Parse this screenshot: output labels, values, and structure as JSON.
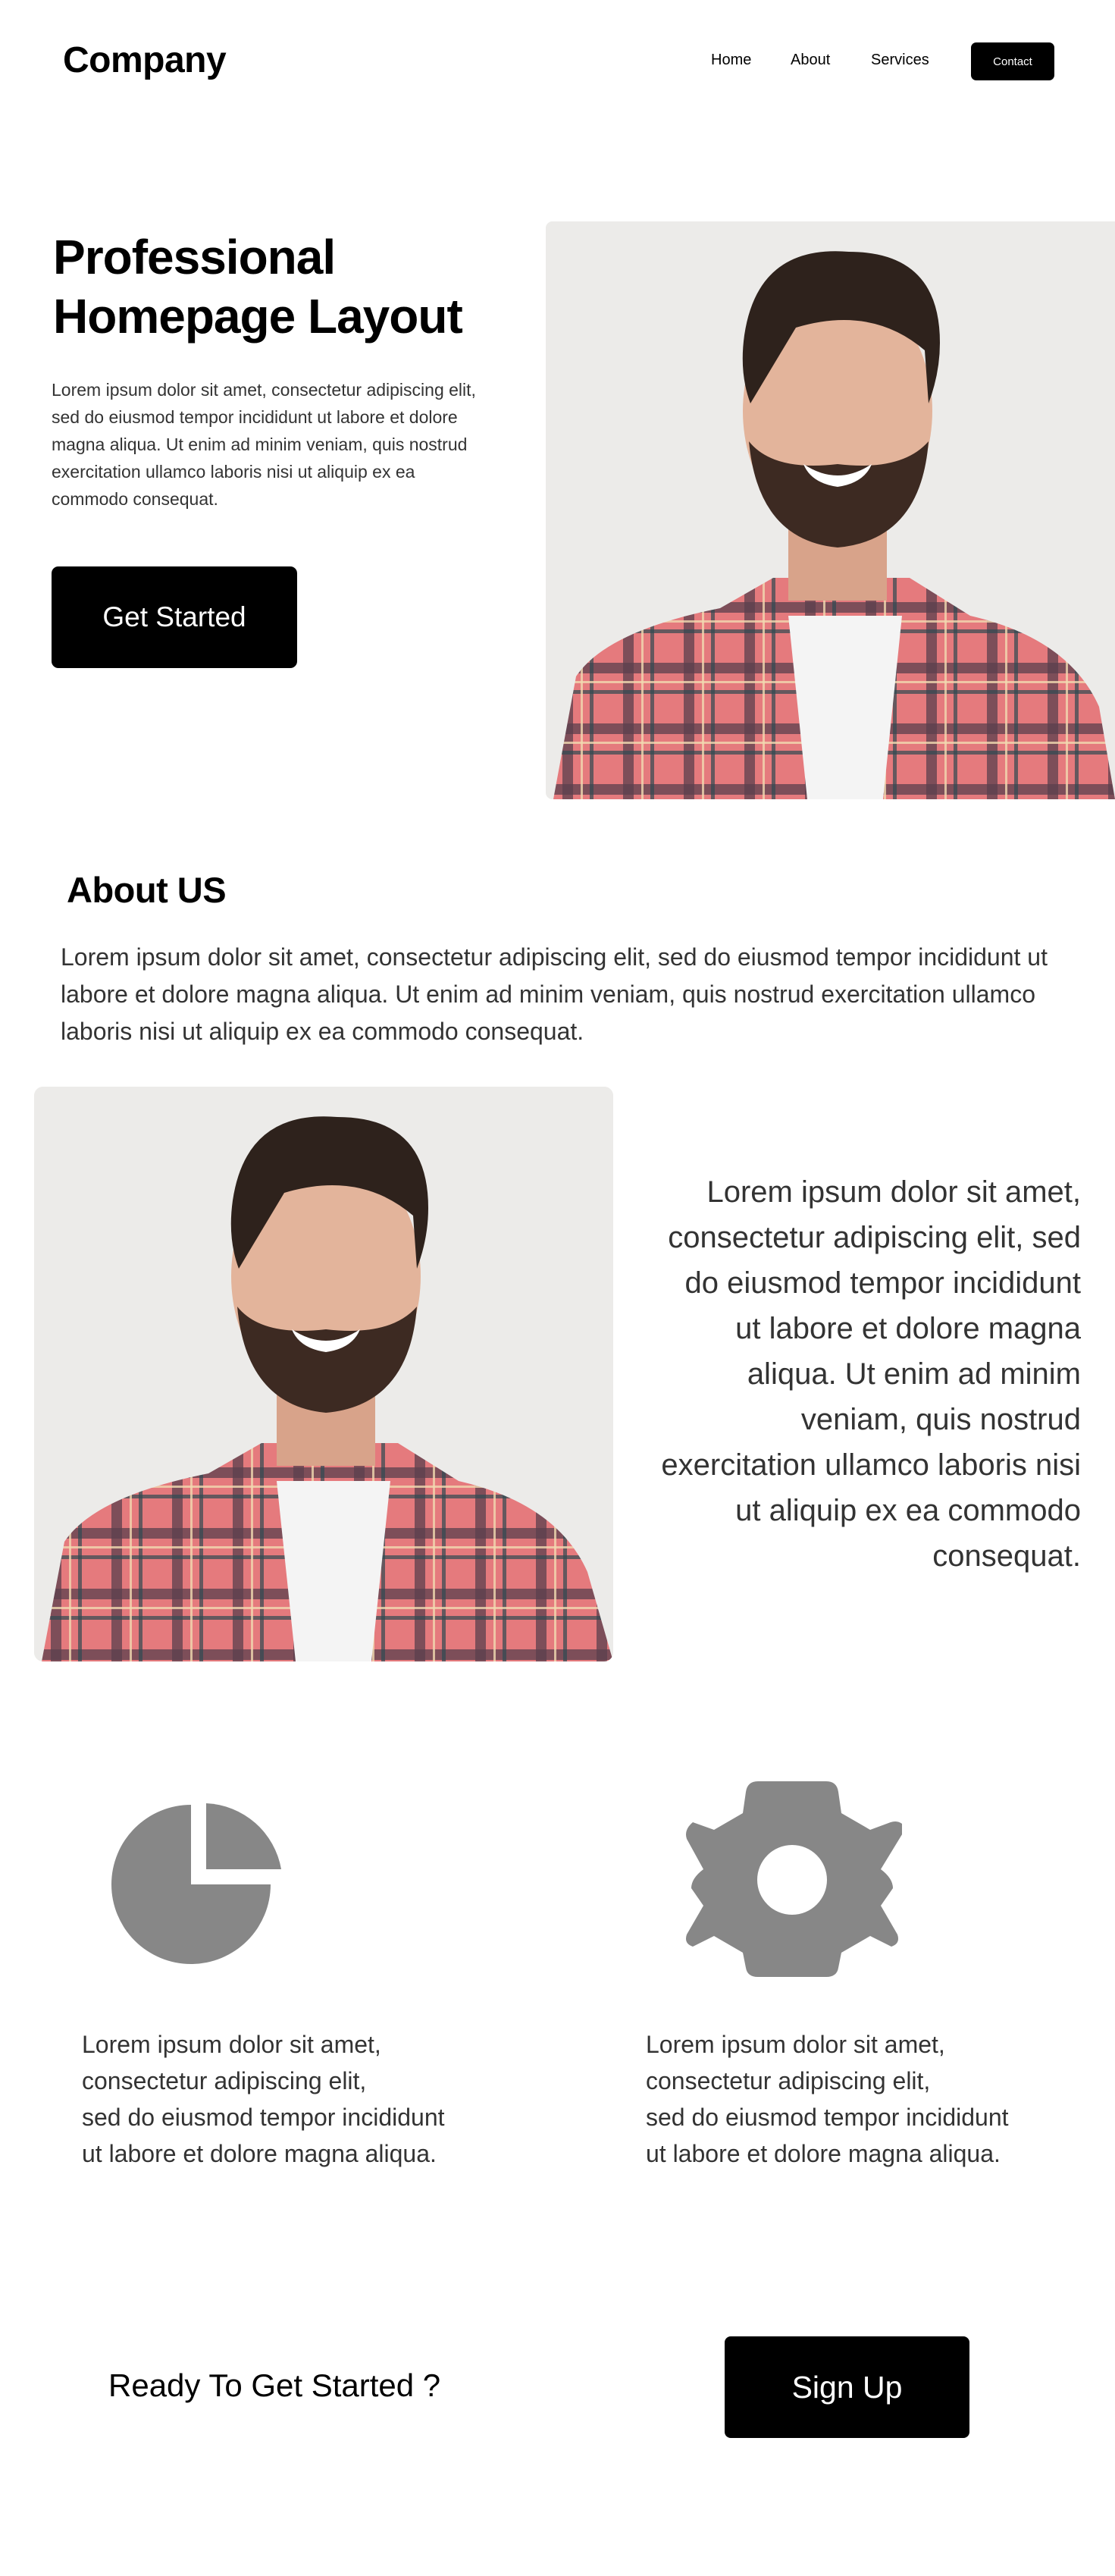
{
  "header": {
    "logo": "Company",
    "nav": {
      "home": "Home",
      "about": "About",
      "services": "Services",
      "contact": "Contact"
    }
  },
  "hero": {
    "title_line1": "Professional",
    "title_line2": "Homepage Layout",
    "text": "Lorem ipsum dolor sit amet, consectetur adipiscing elit, sed do eiusmod tempor incididunt ut labore et dolore magna aliqua. Ut enim ad minim veniam, quis nostrud exercitation ullamco laboris nisi ut aliquip ex ea commodo consequat.",
    "cta_label": "Get Started"
  },
  "about": {
    "title": "About US",
    "text": "Lorem ipsum dolor sit amet, consectetur adipiscing elit, sed do eiusmod tempor incididunt ut labore et dolore magna aliqua. Ut enim ad minim veniam, quis nostrud exercitation ullamco laboris nisi ut aliquip ex ea commodo consequat.",
    "side_text": "Lorem ipsum dolor sit amet, consectetur adipiscing elit, sed do eiusmod tempor incididunt ut labore et dolore magna aliqua. Ut enim ad minim veniam, quis nostrud exercitation ullamco laboris nisi ut aliquip ex ea commodo consequat."
  },
  "features": [
    {
      "icon": "pie-chart-icon",
      "lines": [
        "Lorem ipsum dolor sit amet,",
        "consectetur adipiscing elit,",
        "sed do eiusmod tempor incididunt",
        "ut labore et dolore magna aliqua."
      ]
    },
    {
      "icon": "gear-icon",
      "lines": [
        "Lorem ipsum dolor sit amet,",
        "consectetur adipiscing elit,",
        "sed do eiusmod tempor incididunt",
        "ut labore et dolore magna aliqua."
      ]
    }
  ],
  "cta": {
    "text": "Ready To Get Started ?",
    "signup_label": "Sign Up"
  },
  "colors": {
    "accent": "#000000",
    "icon_gray": "#878787",
    "body_text": "#333333",
    "shirt_red": "#e0747a"
  }
}
